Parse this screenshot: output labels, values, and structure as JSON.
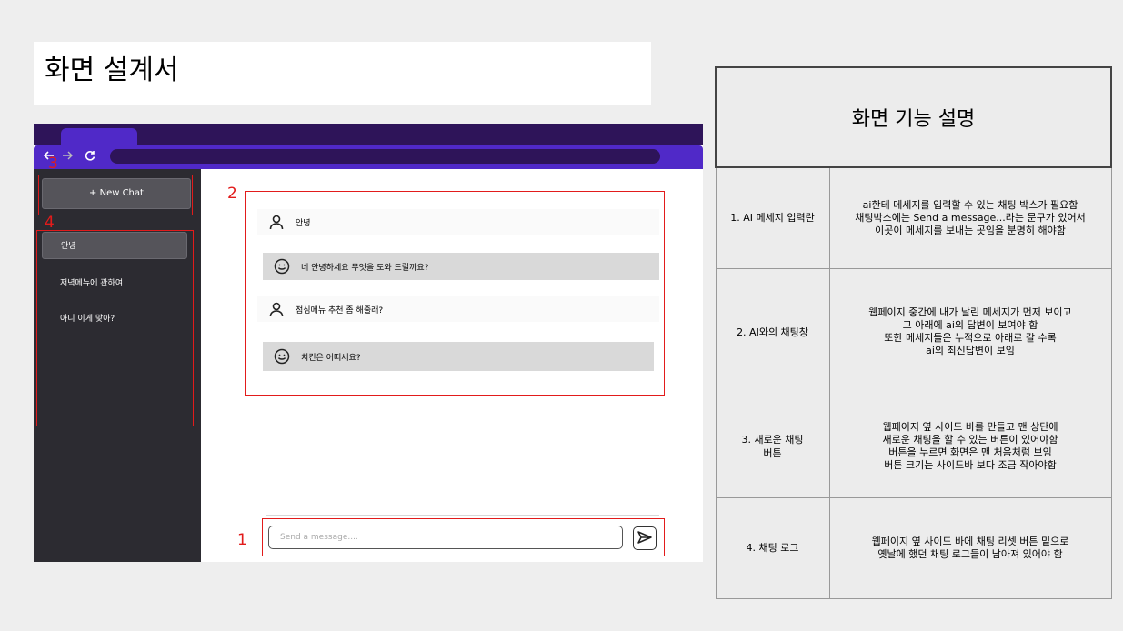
{
  "page": {
    "title": "화면 설계서"
  },
  "mockup": {
    "new_chat_label": "+ New Chat",
    "history": [
      "안녕",
      "저녁메뉴에 관하여",
      "아니 이게 맞아?"
    ],
    "messages": [
      {
        "role": "user",
        "text": "안녕"
      },
      {
        "role": "ai",
        "text": "네 안녕하세요 무엇을 도와 드릴까요?"
      },
      {
        "role": "user",
        "text": "점심메뉴 추천 좀 해줄래?"
      },
      {
        "role": "ai",
        "text": "치킨은 어떠세요?"
      }
    ],
    "input_placeholder": "Send a message....",
    "icons": [
      "back-arrow-icon",
      "forward-arrow-icon",
      "refresh-icon",
      "user-icon",
      "smiley-icon",
      "send-icon"
    ],
    "colors": {
      "tabbar": "#2e1459",
      "navbar": "#5029c8",
      "sidebar": "#2c2b31",
      "annotation": "#e21b1b"
    }
  },
  "annotations": [
    "1",
    "2",
    "3",
    "4"
  ],
  "table": {
    "header": "화면 기능 설명",
    "rows": [
      {
        "label": "1. AI 메세지 입력란",
        "desc": [
          "ai한테 메세지를 입력할 수 있는 채팅 박스가 필요함",
          "채팅박스에는 Send a message...라는 문구가 있어서",
          "이곳이 메세지를 보내는 곳임을 분명히 해야함"
        ]
      },
      {
        "label": "2. AI와의 채팅창",
        "desc": [
          "웹페이지 중간에 내가 날린 메세지가 먼저 보이고",
          "그 아래에 ai의 답변이 보여야 함",
          "또한 메세지들은 누적으로 아래로 갈 수록",
          "ai의 최신답변이 보임"
        ]
      },
      {
        "label": [
          "3. 새로운 채팅",
          "버튼"
        ],
        "desc": [
          "웹페이지 옆 사이드 바를 만들고 맨 상단에",
          "새로운 채팅을 할 수 있는 버튼이 있어야함",
          "버튼을 누르면 화면은 맨 처음처럼 보임",
          "버튼 크기는 사이드바 보다 조금 작아야함"
        ]
      },
      {
        "label": "4. 채팅 로그",
        "desc": [
          "웹페이지 옆 사이드 바에 채팅 리셋 버튼 밑으로",
          "옛날에 했던 채팅 로그들이 남아져 있어야 함"
        ]
      }
    ]
  }
}
